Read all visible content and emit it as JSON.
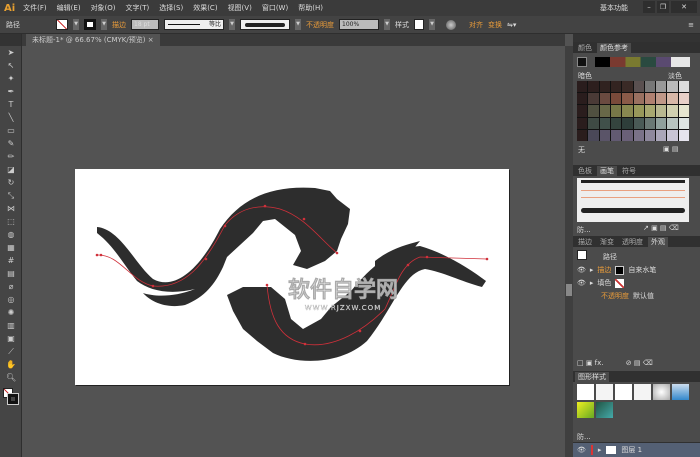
{
  "app": {
    "logo": "Ai",
    "workspace": "基本功能"
  },
  "menu": [
    "文件(F)",
    "编辑(E)",
    "对象(O)",
    "文字(T)",
    "选择(S)",
    "效果(C)",
    "视图(V)",
    "窗口(W)",
    "帮助(H)"
  ],
  "control": {
    "selection": "路径",
    "stroke_label": "描边",
    "stroke_weight": "18 pt",
    "profile": "等比",
    "opacity_label": "不透明度",
    "opacity": "100%",
    "style_label": "样式",
    "align": "对齐",
    "transform": "变换"
  },
  "document_tab": "未标题-1* @ 66.67% (CMYK/预览)",
  "color_panel": {
    "tabs": [
      "颜色",
      "颜色参考"
    ],
    "dark": "暗色",
    "light": "淡色",
    "none": "无",
    "swatches": [
      [
        "#2a1d1d",
        "#2d1f1e",
        "#302220",
        "#332421",
        "#3a2a26",
        "#5a5050",
        "#777",
        "#999",
        "#bbb",
        "#ddd"
      ],
      [
        "#2a1d1d",
        "#4a3a36",
        "#6a4a40",
        "#7a4a3a",
        "#8a5a48",
        "#9a7060",
        "#b08070",
        "#c09888",
        "#d8b8a8",
        "#e8d0c8"
      ],
      [
        "#2a1d1d",
        "#505040",
        "#686848",
        "#787848",
        "#888850",
        "#98985a",
        "#a8a870",
        "#b8b890",
        "#d0d0b0",
        "#e6e6d0"
      ],
      [
        "#2a1d1d",
        "#3f4a44",
        "#40504a",
        "#34443e",
        "#2e3e3a",
        "#4a5a56",
        "#6a7874",
        "#90a09c",
        "#b8c4c0",
        "#dde4e2"
      ],
      [
        "#2a1d1d",
        "#4a4858",
        "#5a5468",
        "#625a72",
        "#6a6078",
        "#7a7288",
        "#8e889c",
        "#aaa6b8",
        "#c8c4d4",
        "#e6e4ee"
      ]
    ]
  },
  "brush_panel": {
    "tabs": [
      "色板",
      "画笔",
      "符号"
    ],
    "footer": "防..."
  },
  "appearance_panel": {
    "tabs": [
      "描边",
      "渐变",
      "透明度",
      "外观"
    ],
    "title": "路径",
    "stroke_label": "描边",
    "stroke_value": "自来水笔",
    "fill_label": "填色",
    "opacity_label": "不透明度",
    "opacity_value": "默认值"
  },
  "graphic_styles": {
    "title": "图形样式",
    "footer": "防..."
  },
  "layers_panel": {
    "tabs": [
      "图层",
      "画板"
    ],
    "layer": "图层 1"
  },
  "watermark": {
    "cn": "软件自学网",
    "url": "WWW.RJZXW.COM"
  },
  "colors": {
    "accent": "#e89b3a",
    "path": "#d0303a",
    "ink": "#2d2d2d"
  }
}
